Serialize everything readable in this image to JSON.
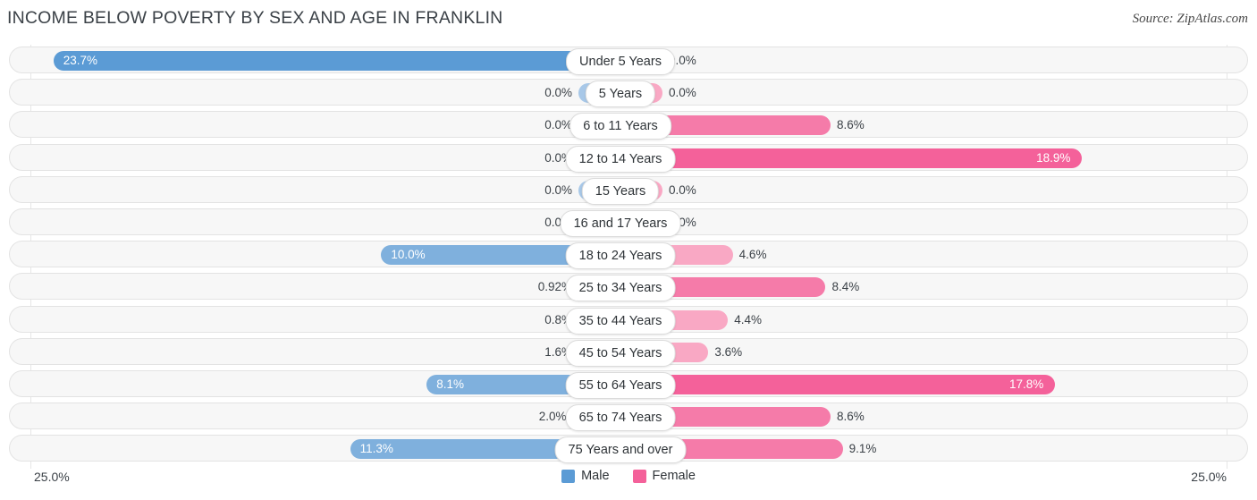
{
  "header": {
    "title": "Income Below Poverty by Sex and Age in Franklin",
    "source": "Source: ZipAtlas.com"
  },
  "axis": {
    "left_label": "25.0%",
    "right_label": "25.0%",
    "max": 25.0
  },
  "legend": {
    "items": [
      {
        "label": "Male",
        "color": "#5b9bd5"
      },
      {
        "label": "Female",
        "color": "#f4619a"
      }
    ]
  },
  "colors": {
    "male_strong": "#5b9bd5",
    "male_mid": "#7fb0dd",
    "male_light": "#a8c8e8",
    "female_strong": "#f4619a",
    "female_mid": "#f57ba9",
    "female_light": "#f9a8c4",
    "track": "#f7f7f7",
    "track_border": "#e3e3e3",
    "grid": "#e6e6e6"
  },
  "chart_data": {
    "type": "bar",
    "orientation": "horizontal-diverging",
    "title": "Income Below Poverty by Sex and Age in Franklin",
    "xlabel": "",
    "ylabel": "",
    "xlim": [
      -25.0,
      25.0
    ],
    "grid": true,
    "legend_position": "bottom-center",
    "categories": [
      "Under 5 Years",
      "5 Years",
      "6 to 11 Years",
      "12 to 14 Years",
      "15 Years",
      "16 and 17 Years",
      "18 to 24 Years",
      "25 to 34 Years",
      "35 to 44 Years",
      "45 to 54 Years",
      "55 to 64 Years",
      "65 to 74 Years",
      "75 Years and over"
    ],
    "series": [
      {
        "name": "Male",
        "color": "#5b9bd5",
        "values": [
          23.7,
          0.0,
          0.0,
          0.0,
          0.0,
          0.0,
          10.0,
          0.92,
          0.8,
          1.6,
          8.1,
          2.0,
          11.3
        ],
        "labels": [
          "23.7%",
          "0.0%",
          "0.0%",
          "0.0%",
          "0.0%",
          "0.0%",
          "10.0%",
          "0.92%",
          "0.8%",
          "1.6%",
          "8.1%",
          "2.0%",
          "11.3%"
        ]
      },
      {
        "name": "Female",
        "color": "#f4619a",
        "values": [
          0.0,
          0.0,
          8.6,
          18.9,
          0.0,
          0.0,
          4.6,
          8.4,
          4.4,
          3.6,
          17.8,
          8.6,
          9.1
        ],
        "labels": [
          "0.0%",
          "0.0%",
          "8.6%",
          "18.9%",
          "0.0%",
          "0.0%",
          "4.6%",
          "8.4%",
          "4.4%",
          "3.6%",
          "17.8%",
          "8.6%",
          "9.1%"
        ]
      }
    ]
  },
  "rows": [
    {
      "category": "Under 5 Years",
      "male": 23.7,
      "male_label": "23.7%",
      "female": 0.0,
      "female_label": "0.0%"
    },
    {
      "category": "5 Years",
      "male": 0.0,
      "male_label": "0.0%",
      "female": 0.0,
      "female_label": "0.0%"
    },
    {
      "category": "6 to 11 Years",
      "male": 0.0,
      "male_label": "0.0%",
      "female": 8.6,
      "female_label": "8.6%"
    },
    {
      "category": "12 to 14 Years",
      "male": 0.0,
      "male_label": "0.0%",
      "female": 18.9,
      "female_label": "18.9%"
    },
    {
      "category": "15 Years",
      "male": 0.0,
      "male_label": "0.0%",
      "female": 0.0,
      "female_label": "0.0%"
    },
    {
      "category": "16 and 17 Years",
      "male": 0.0,
      "male_label": "0.0%",
      "female": 0.0,
      "female_label": "0.0%"
    },
    {
      "category": "18 to 24 Years",
      "male": 10.0,
      "male_label": "10.0%",
      "female": 4.6,
      "female_label": "4.6%"
    },
    {
      "category": "25 to 34 Years",
      "male": 0.92,
      "male_label": "0.92%",
      "female": 8.4,
      "female_label": "8.4%"
    },
    {
      "category": "35 to 44 Years",
      "male": 0.8,
      "male_label": "0.8%",
      "female": 4.4,
      "female_label": "4.4%"
    },
    {
      "category": "45 to 54 Years",
      "male": 1.6,
      "male_label": "1.6%",
      "female": 3.6,
      "female_label": "3.6%"
    },
    {
      "category": "55 to 64 Years",
      "male": 8.1,
      "male_label": "8.1%",
      "female": 17.8,
      "female_label": "17.8%"
    },
    {
      "category": "65 to 74 Years",
      "male": 2.0,
      "male_label": "2.0%",
      "female": 8.6,
      "female_label": "8.6%"
    },
    {
      "category": "75 Years and over",
      "male": 11.3,
      "male_label": "11.3%",
      "female": 9.1,
      "female_label": "9.1%"
    }
  ]
}
